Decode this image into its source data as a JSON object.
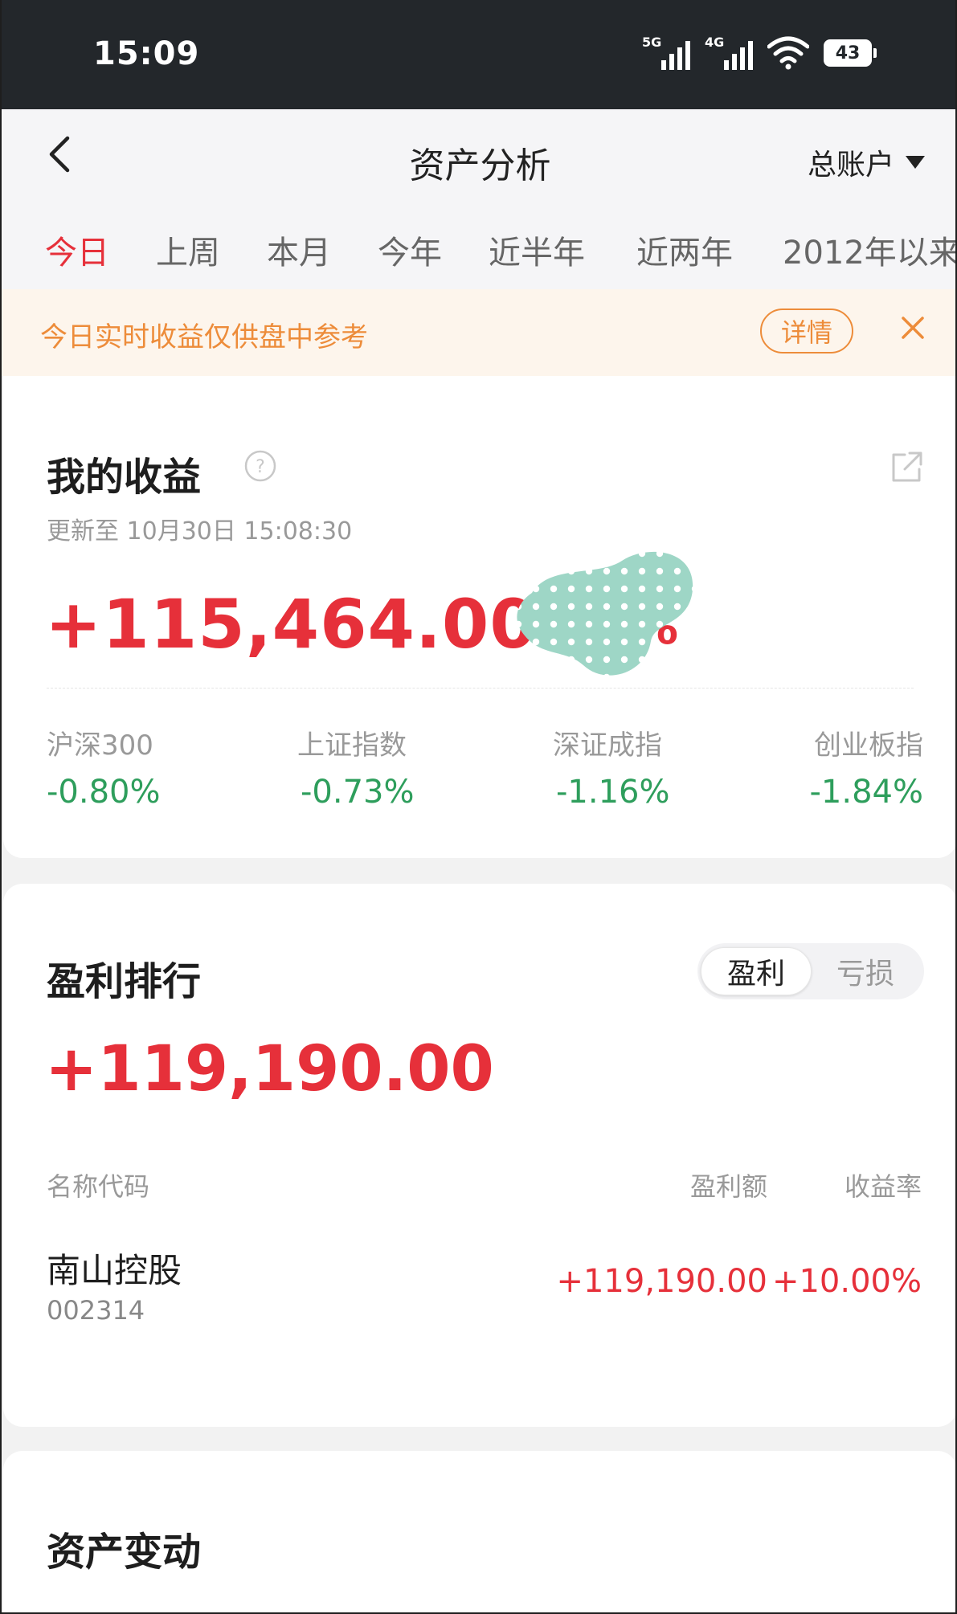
{
  "status_bar": {
    "time": "15:09",
    "network1": "5G",
    "network2": "4G",
    "battery": "43"
  },
  "header": {
    "title": "资产分析",
    "account": "总账户"
  },
  "tabs": [
    "今日",
    "上周",
    "本月",
    "今年",
    "近半年",
    "近两年",
    "2012年以来"
  ],
  "active_tab": "今日",
  "notice": {
    "text": "今日实时收益仅供盘中参考",
    "detail": "详情"
  },
  "my_profit": {
    "title": "我的收益",
    "update": "更新至 10月30日 15:08:30",
    "amount": "+115,464.00",
    "pct_visible": "%",
    "indices": [
      {
        "name": "沪深300",
        "value": "-0.80%"
      },
      {
        "name": "上证指数",
        "value": "-0.73%"
      },
      {
        "name": "深证成指",
        "value": "-1.16%"
      },
      {
        "name": "创业板指",
        "value": "-1.84%"
      }
    ]
  },
  "ranking": {
    "title": "盈利排行",
    "toggle_on": "盈利",
    "toggle_off": "亏损",
    "total": "+119,190.00",
    "columns": [
      "名称代码",
      "盈利额",
      "收益率"
    ],
    "rows": [
      {
        "name": "南山控股",
        "code": "002314",
        "amount": "+119,190.00",
        "rate": "+10.00%"
      }
    ]
  },
  "asset_change": {
    "title": "资产变动"
  },
  "colors": {
    "accent_red": "#e6303a",
    "green": "#2e9e5c",
    "notice_orange": "#ed8c3a",
    "status_bg": "#23272b"
  }
}
